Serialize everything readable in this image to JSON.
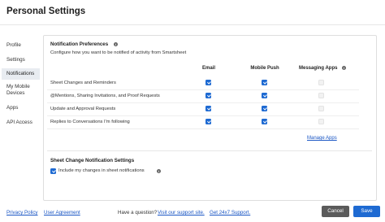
{
  "dialog": {
    "title": "Personal Settings"
  },
  "sidebar": {
    "items": [
      {
        "label": "Profile"
      },
      {
        "label": "Settings"
      },
      {
        "label": "Notifications"
      },
      {
        "label": "My Mobile Devices"
      },
      {
        "label": "Apps"
      },
      {
        "label": "API Access"
      }
    ],
    "active_index": 2
  },
  "notification_prefs": {
    "title": "Notification Preferences",
    "description": "Configure how you want to be notified of activity from Smartsheet",
    "columns": [
      "Email",
      "Mobile Push",
      "Messaging Apps"
    ],
    "rows": [
      {
        "label": "Sheet Changes and Reminders",
        "email": true,
        "mobile_push": true,
        "messaging_apps": false
      },
      {
        "label": "@Mentions, Sharing Invitations, and Proof Requests",
        "email": true,
        "mobile_push": true,
        "messaging_apps": false
      },
      {
        "label": "Update and Approval Requests",
        "email": true,
        "mobile_push": true,
        "messaging_apps": false
      },
      {
        "label": "Replies to Conversations I'm following",
        "email": true,
        "mobile_push": true,
        "messaging_apps": false
      }
    ],
    "manage_apps_link": "Manage Apps"
  },
  "sheet_change_settings": {
    "title": "Sheet Change Notification Settings",
    "include_my_changes_label": "Include my changes in sheet notifications",
    "include_my_changes": true
  },
  "footer": {
    "privacy_policy": "Privacy Policy",
    "user_agreement": "User Agreement",
    "question_text": "Have a question?",
    "support_site_link": "Visit our support site.",
    "support_247_link": "Get 24x7 Support.",
    "cancel_label": "Cancel",
    "save_label": "Save"
  },
  "colors": {
    "accent": "#1e6ad2",
    "link": "#1a56c4",
    "cancel_button": "#5b5b5b"
  }
}
